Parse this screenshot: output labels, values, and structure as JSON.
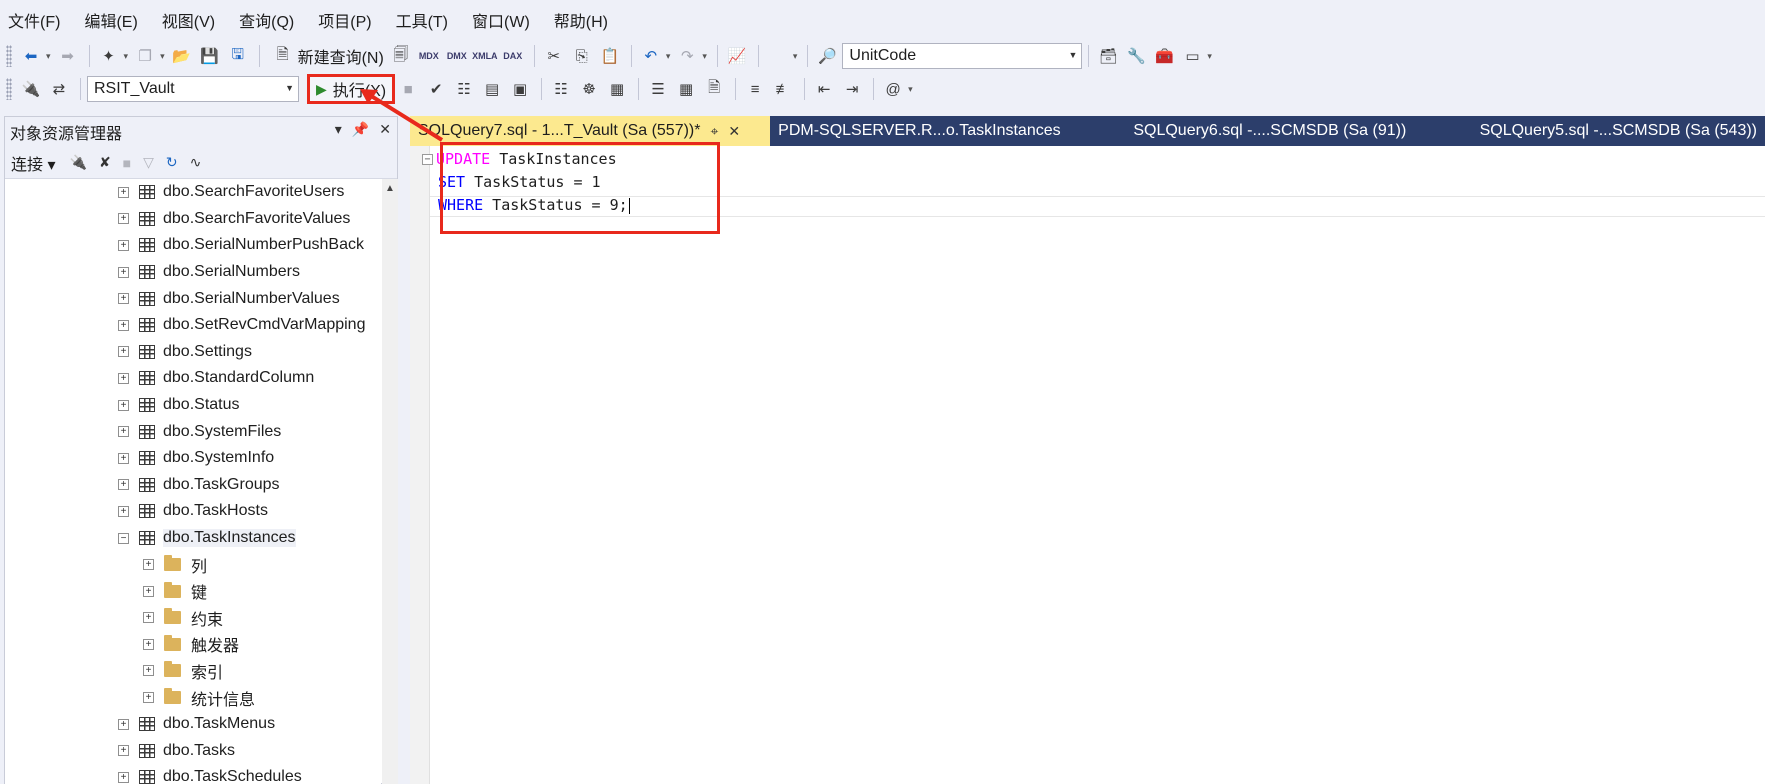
{
  "menubar": {
    "items": [
      "文件(F)",
      "编辑(E)",
      "视图(V)",
      "查询(Q)",
      "项目(P)",
      "工具(T)",
      "窗口(W)",
      "帮助(H)"
    ]
  },
  "toolbar1": {
    "new_query": "新建查询(N)",
    "small_labels": [
      "MDX",
      "DMX",
      "XMLA",
      "DAX"
    ],
    "search_combo": "UnitCode"
  },
  "toolbar2": {
    "database": "RSIT_Vault",
    "execute": "执行(X)"
  },
  "object_explorer": {
    "title": "对象资源管理器",
    "connect": "连接",
    "tree": [
      {
        "label": "dbo.SearchFavoriteUsers",
        "type": "table",
        "expander": "+"
      },
      {
        "label": "dbo.SearchFavoriteValues",
        "type": "table",
        "expander": "+"
      },
      {
        "label": "dbo.SerialNumberPushBack",
        "type": "table",
        "expander": "+"
      },
      {
        "label": "dbo.SerialNumbers",
        "type": "table",
        "expander": "+"
      },
      {
        "label": "dbo.SerialNumberValues",
        "type": "table",
        "expander": "+"
      },
      {
        "label": "dbo.SetRevCmdVarMapping",
        "type": "table",
        "expander": "+"
      },
      {
        "label": "dbo.Settings",
        "type": "table",
        "expander": "+"
      },
      {
        "label": "dbo.StandardColumn",
        "type": "table",
        "expander": "+"
      },
      {
        "label": "dbo.Status",
        "type": "table",
        "expander": "+"
      },
      {
        "label": "dbo.SystemFiles",
        "type": "table",
        "expander": "+"
      },
      {
        "label": "dbo.SystemInfo",
        "type": "table",
        "expander": "+"
      },
      {
        "label": "dbo.TaskGroups",
        "type": "table",
        "expander": "+"
      },
      {
        "label": "dbo.TaskHosts",
        "type": "table",
        "expander": "+"
      },
      {
        "label": "dbo.TaskInstances",
        "type": "table",
        "expander": "-",
        "selected": true
      },
      {
        "label": "列",
        "type": "folder",
        "expander": "+"
      },
      {
        "label": "键",
        "type": "folder",
        "expander": "+"
      },
      {
        "label": "约束",
        "type": "folder",
        "expander": "+"
      },
      {
        "label": "触发器",
        "type": "folder",
        "expander": "+"
      },
      {
        "label": "索引",
        "type": "folder",
        "expander": "+"
      },
      {
        "label": "统计信息",
        "type": "folder",
        "expander": "+"
      },
      {
        "label": "dbo.TaskMenus",
        "type": "table",
        "expander": "+"
      },
      {
        "label": "dbo.Tasks",
        "type": "table",
        "expander": "+"
      },
      {
        "label": "dbo.TaskSchedules",
        "type": "table",
        "expander": "+"
      }
    ]
  },
  "tabs": [
    {
      "label": "SQLQuery7.sql - 1...T_Vault (Sa (557))*",
      "active": true
    },
    {
      "label": "PDM-SQLSERVER.R...o.TaskInstances",
      "active": false
    },
    {
      "label": "SQLQuery6.sql -....SCMSDB (Sa (91))",
      "active": false
    },
    {
      "label": "SQLQuery5.sql -...SCMSDB (Sa (543))",
      "active": false
    }
  ],
  "editor": {
    "line1_kw": "UPDATE",
    "line1_rest": " TaskInstances",
    "line2_kw": "SET",
    "line2_rest": " TaskStatus = 1",
    "line3_kw": "WHERE",
    "line3_rest": " TaskStatus = 9;"
  },
  "colors": {
    "highlight_red": "#e8291c",
    "active_tab": "#fce98f",
    "tab_strip": "#2c3e6b",
    "sql_keyword": "#0000ff",
    "sql_update_keyword": "#ff00ff"
  }
}
